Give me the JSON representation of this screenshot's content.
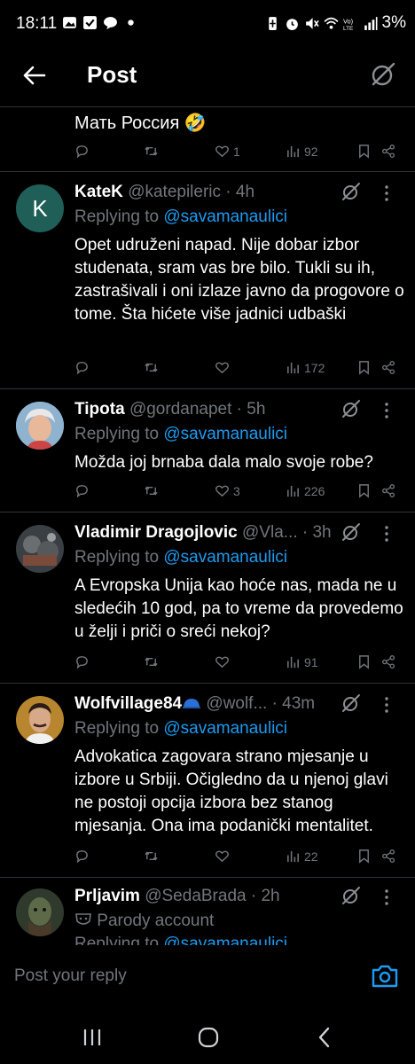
{
  "status_bar": {
    "time": "18:11",
    "battery": "3%",
    "left_icons": [
      "image-icon",
      "check-icon",
      "chat-bubble-icon",
      "dot-icon"
    ],
    "right_icons": [
      "battery-saver-icon",
      "alarm-icon",
      "mute-icon",
      "wifi-icon",
      "volte-icon",
      "signal-icon"
    ]
  },
  "header": {
    "title": "Post"
  },
  "top_tweet": {
    "text": "Мать Россия 🤣",
    "likes": "1",
    "views": "92"
  },
  "replies": [
    {
      "name": "KateK",
      "handle": "@katepileric · 4h",
      "avatar_letter": "K",
      "replying_label": "Replying to ",
      "mention": "@savamanaulici",
      "text": "Opet udruženi napad. Nije dobar izbor studenata, sram vas bre bilo. Tukli su ih, zastrašivali i oni izlaze javno da progovore o tome. Šta hićete više jadnici udbaški",
      "likes": "",
      "views": "172"
    },
    {
      "name": "Tipota",
      "handle": "@gordanapet · 5h",
      "replying_label": "Replying to ",
      "mention": "@savamanaulici",
      "text": "Možda joj brnaba dala malo svoje robe?",
      "likes": "3",
      "views": "226"
    },
    {
      "name": "Vladimir Dragojlovic",
      "handle": "@Vla... · 3h",
      "replying_label": "Replying to ",
      "mention": "@savamanaulici",
      "text": "A Evropska Unija kao hoće nas, mada ne u sledećih 10 god, pa to vreme da provedemo u želji i priči o sreći nekoj?",
      "likes": "",
      "views": "91"
    },
    {
      "name": "Wolfvillage84",
      "handle": "@wolf... · 43m",
      "replying_label": "Replying to ",
      "mention": "@savamanaulici",
      "text": "Advokatica zagovara strano mjesanje u izbore u Srbiji. Očigledno da u njenoj glavi ne postoji opcija izbora bez stanog mjesanja. Ona ima podanički mentalitet.",
      "likes": "",
      "views": "22"
    },
    {
      "name": "Prljavim",
      "handle": "@SedaBrada · 2h",
      "parody_label": "Parody account",
      "replying_label": "Replying to ",
      "mention": "@savamanaulici"
    }
  ],
  "reply_bar": {
    "placeholder": "Post your reply"
  },
  "colors": {
    "accent": "#1d9bf0",
    "muted": "#71767b",
    "divider": "#2f3336"
  }
}
